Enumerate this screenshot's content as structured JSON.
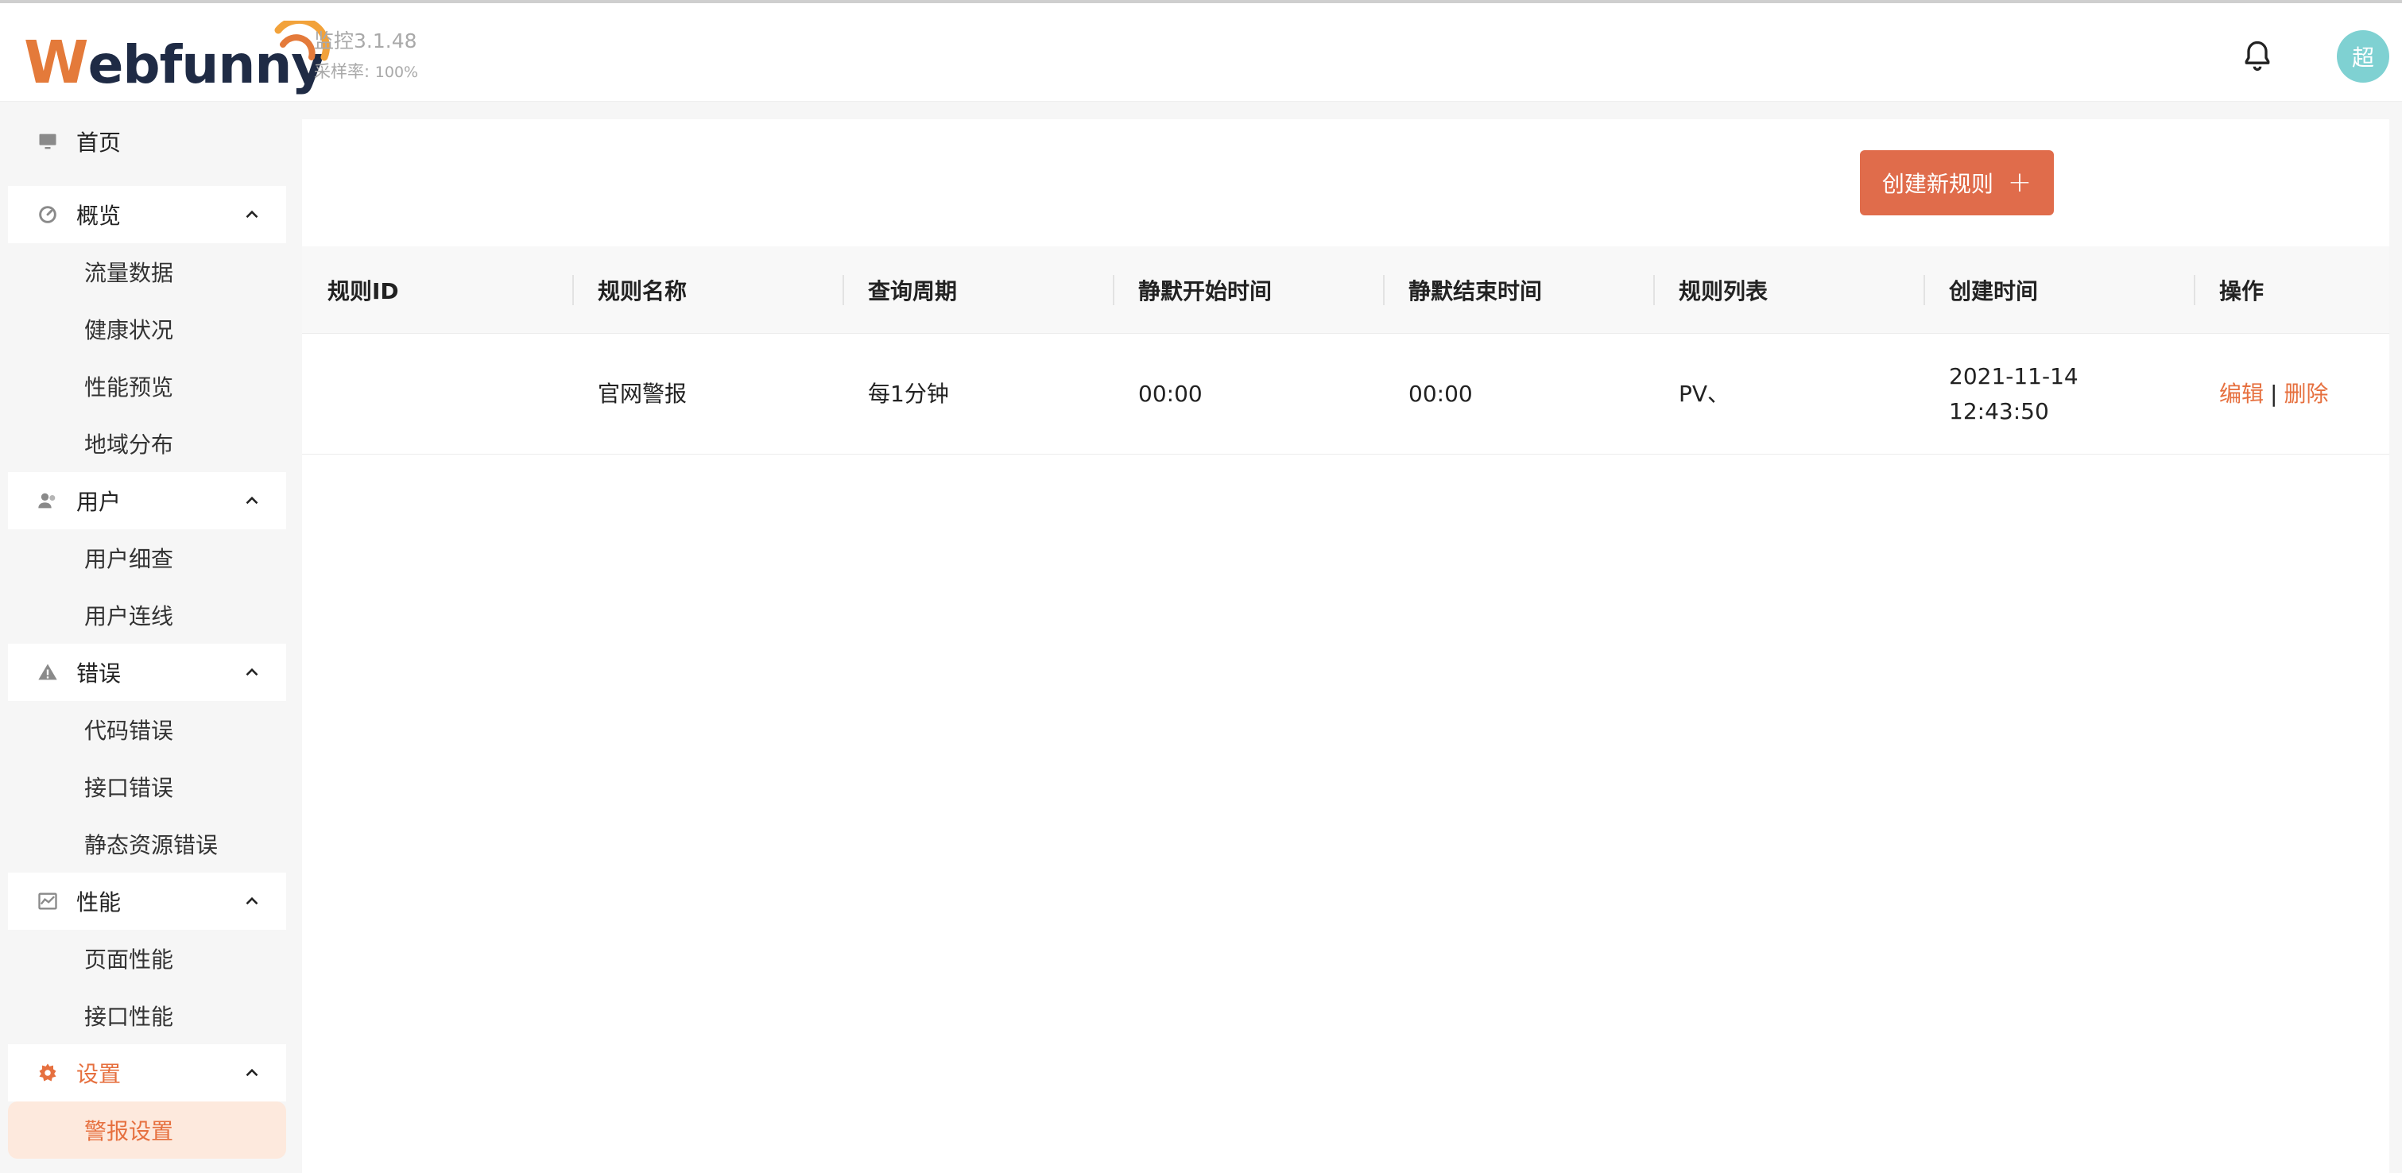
{
  "app": {
    "logo_text_w": "W",
    "logo_text_rest": "ebfunny",
    "version": "监控3.1.48",
    "sample_rate_label": "采样率:",
    "sample_rate_value": "100%",
    "avatar_text": "超",
    "bell_icon": "bell-icon"
  },
  "sidebar": {
    "home": {
      "label": "首页",
      "icon": "monitor-icon"
    },
    "groups": [
      {
        "label": "概览",
        "icon": "gauge-icon",
        "items": [
          "流量数据",
          "健康状况",
          "性能预览",
          "地域分布"
        ]
      },
      {
        "label": "用户",
        "icon": "users-icon",
        "items": [
          "用户细查",
          "用户连线"
        ]
      },
      {
        "label": "错误",
        "icon": "warning-icon",
        "items": [
          "代码错误",
          "接口错误",
          "静态资源错误"
        ]
      },
      {
        "label": "性能",
        "icon": "chart-icon",
        "items": [
          "页面性能",
          "接口性能"
        ]
      },
      {
        "label": "设置",
        "icon": "gear-icon",
        "items": [
          "警报设置"
        ],
        "active": true
      }
    ],
    "active_item": "警报设置",
    "accent": "#e6703f"
  },
  "main": {
    "create_button": "创建新规则",
    "columns": [
      "规则ID",
      "规则名称",
      "查询周期",
      "静默开始时间",
      "静默结束时间",
      "规则列表",
      "创建时间",
      "操作"
    ],
    "rows": [
      {
        "rule_id": "",
        "rule_name": "官网警报",
        "period": "每1分钟",
        "silence_start": "00:00",
        "silence_end": "00:00",
        "rule_list": "PV、",
        "created_date": "2021-11-14",
        "created_time": "12:43:50",
        "edit": "编辑",
        "separator": "|",
        "delete": "删除"
      }
    ],
    "button_color": "#e06c4b"
  }
}
